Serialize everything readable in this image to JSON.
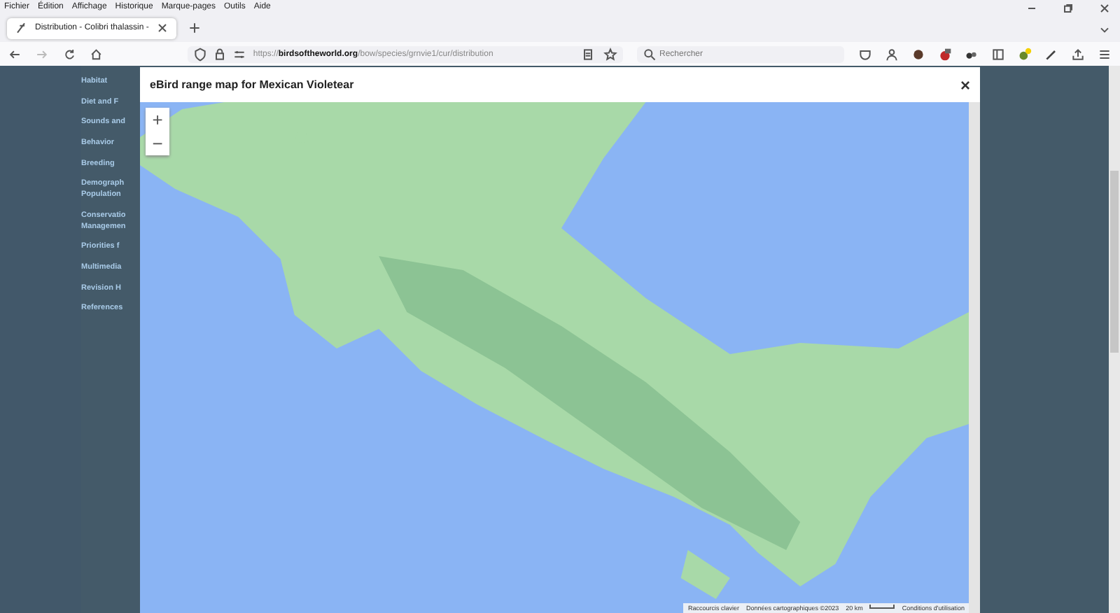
{
  "menu": [
    "Fichier",
    "Édition",
    "Affichage",
    "Historique",
    "Marque-pages",
    "Outils",
    "Aide"
  ],
  "tabs": [
    {
      "title": "Distribution - Colibri thalassin -",
      "selected": true
    }
  ],
  "address": {
    "prefix": "https://",
    "host": "birdsoftheworld.org",
    "path": "/bow/species/grnvie1/cur/distribution"
  },
  "search": {
    "placeholder": "Rechercher"
  },
  "sidebar": {
    "items": [
      "Habitat",
      "Diet and F",
      "Sounds and",
      "Behavior",
      "Breeding",
      "Demograph\nPopulation",
      "Conservatio\nManagemen",
      "Priorities f",
      "Multimedia",
      "Revision H",
      "References"
    ]
  },
  "modal": {
    "title": "eBird range map for Mexican Violetear",
    "close": "×",
    "zoom_in": "+",
    "zoom_out": "−",
    "attribution": [
      "Raccourcis clavier",
      "Données cartographiques ©2023",
      "20 km",
      "Conditions d'utilisation"
    ]
  }
}
